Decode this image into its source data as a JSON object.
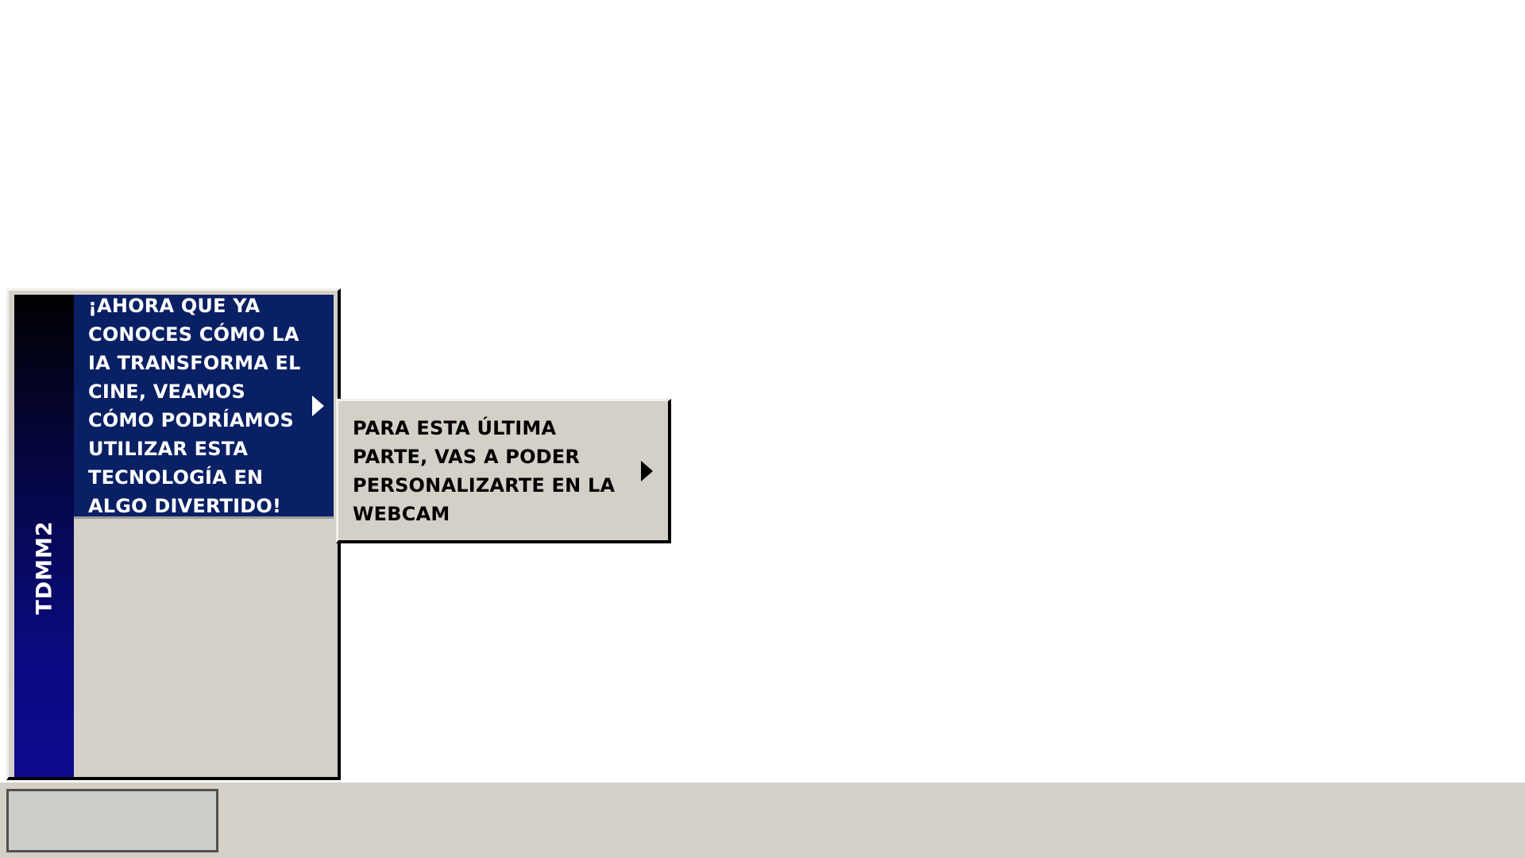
{
  "start_menu": {
    "brand": "TDMM2",
    "items": [
      {
        "label": "¡Ahora que ya conoces cómo la IA transforma el cine, veamos cómo podríamos utilizar esta tecnología en algo divertido!",
        "has_submenu": true,
        "highlighted": true
      }
    ]
  },
  "submenu": {
    "items": [
      {
        "label": "Para esta última parte, vas a poder personalizarte en la webcam",
        "has_submenu": true
      }
    ]
  },
  "taskbar": {
    "start_button_label": ""
  },
  "colors": {
    "menu_bg": "#d4d0c8",
    "highlight_bg": "#0a2064",
    "banner_top": "#000000",
    "banner_bottom": "#0c0a8e"
  }
}
